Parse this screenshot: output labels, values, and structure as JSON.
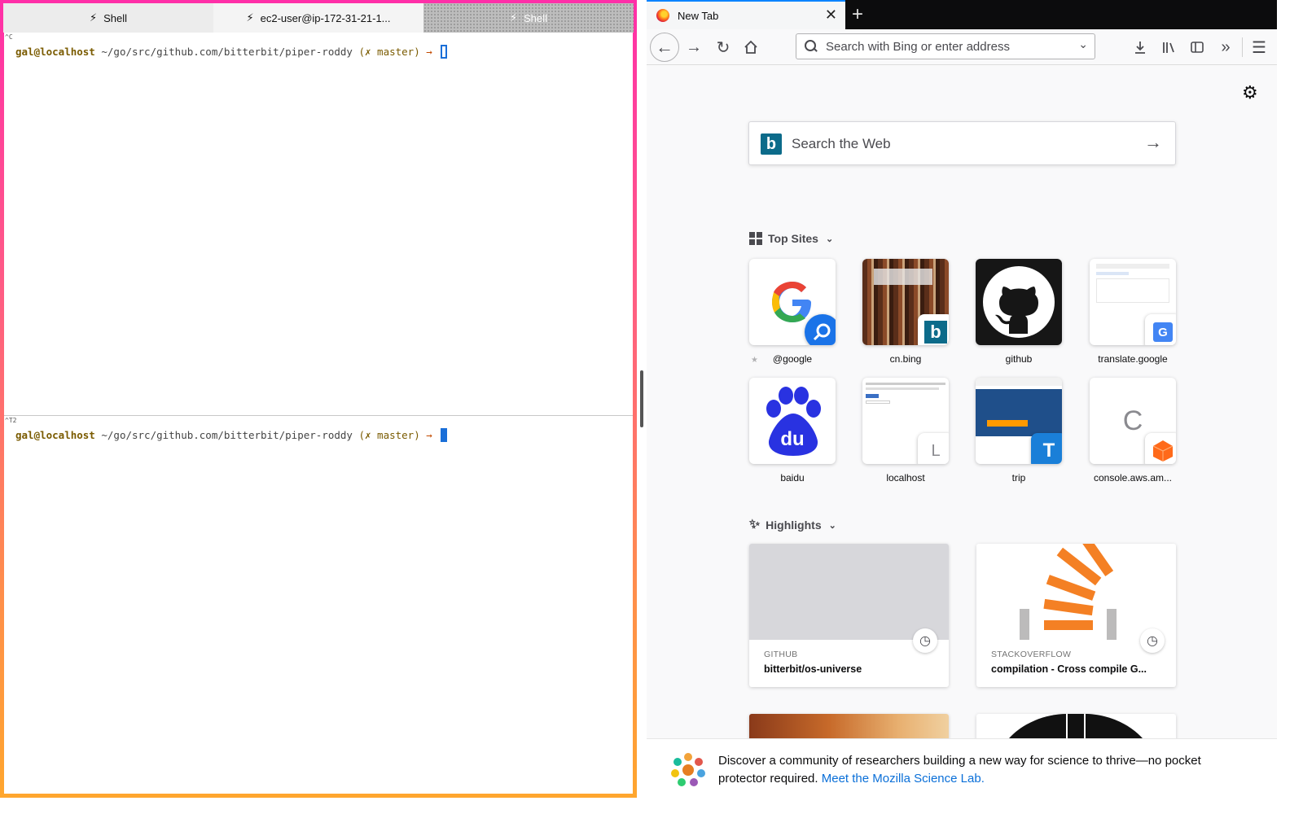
{
  "terminal": {
    "tabs": [
      {
        "label": "Shell",
        "icon": "bolt-icon"
      },
      {
        "label": "ec2-user@ip-172-31-21-1..."
      },
      {
        "label": "Shell"
      }
    ],
    "panes": [
      {
        "marker": "^C",
        "user_host": "gal@localhost",
        "path": "~/go/src/github.com/bitterbit/piper-roddy",
        "branch": "(✗ master)",
        "arrow": "→"
      },
      {
        "marker": "^T2",
        "user_host": "gal@localhost",
        "path": "~/go/src/github.com/bitterbit/piper-roddy",
        "branch": "(✗ master)",
        "arrow": "→"
      }
    ]
  },
  "browser": {
    "tab": {
      "title": "New Tab",
      "close": "✕"
    },
    "new_tab": "+",
    "toolbar": {
      "url_placeholder": "Search with Bing or enter address"
    },
    "search": {
      "placeholder": "Search the Web",
      "provider_icon": "b"
    },
    "top_sites": {
      "heading": "Top Sites",
      "sites": [
        {
          "label": "@google",
          "letter": "G"
        },
        {
          "label": "cn.bing",
          "letter": "b"
        },
        {
          "label": "github"
        },
        {
          "label": "translate.google",
          "letter": "G"
        },
        {
          "label": "baidu",
          "letter": "du"
        },
        {
          "label": "localhost",
          "letter": "L"
        },
        {
          "label": "trip",
          "letter": "T"
        },
        {
          "label": "console.aws.am...",
          "letter": "C"
        }
      ]
    },
    "highlights": {
      "heading": "Highlights",
      "cards": [
        {
          "source": "GITHUB",
          "title": "bitterbit/os-universe"
        },
        {
          "source": "STACKOVERFLOW",
          "title": "compilation - Cross compile G..."
        }
      ]
    },
    "snippet": {
      "text": "Discover a community of researchers building a new way for science to thrive—no pocket protector required.",
      "link": "Meet the Mozilla Science Lab."
    }
  },
  "colors": {
    "terminal_gradient_top": "#ff2fa8",
    "terminal_gradient_bottom": "#ffa62e",
    "accent_blue": "#0a84ff",
    "cursor_blue": "#1a6fd8"
  }
}
